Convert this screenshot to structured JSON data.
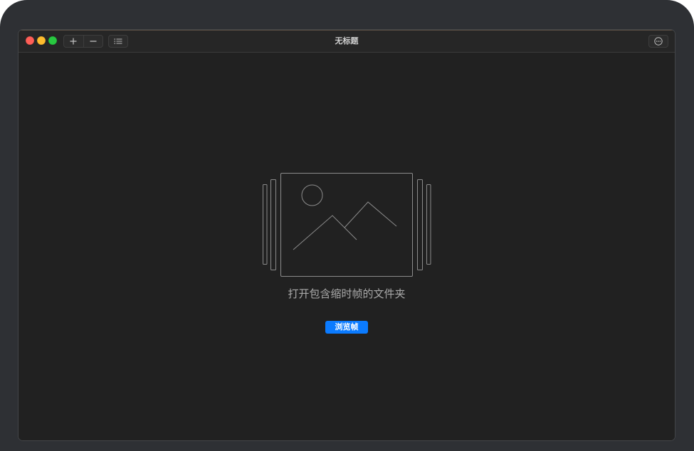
{
  "window": {
    "title": "无标题"
  },
  "toolbar": {
    "traffic_lights": [
      {
        "icon": "close-icon",
        "color": "#ff5f57"
      },
      {
        "icon": "minimize-icon",
        "color": "#febc2e"
      },
      {
        "icon": "zoom-icon",
        "color": "#28c840"
      }
    ],
    "add_icon": "plus-icon",
    "remove_icon": "minus-icon",
    "list_icon": "list-icon",
    "more_icon": "more-icon"
  },
  "empty_state": {
    "illustration_icon": "image-frames-icon",
    "message": "打开包含缩时帧的文件夹",
    "browse_button_label": "浏览帧"
  },
  "colors": {
    "accent": "#0b7bff"
  }
}
